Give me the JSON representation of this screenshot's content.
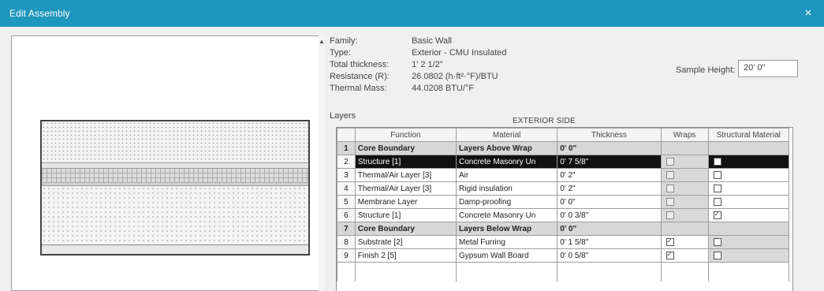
{
  "window": {
    "title": "Edit Assembly",
    "close_icon": "×"
  },
  "assembly": {
    "family_label": "Family:",
    "family_value": "Basic Wall",
    "type_label": "Type:",
    "type_value": "Exterior - CMU Insulated",
    "total_thickness_label": "Total thickness:",
    "total_thickness_value": "1' 2 1/2\"",
    "resistance_label": "Resistance (R):",
    "resistance_value": "26.0802 (h·ft²·°F)/BTU",
    "thermal_mass_label": "Thermal Mass:",
    "thermal_mass_value": "44.0208 BTU/°F",
    "sample_height_label": "Sample Height:",
    "sample_height_value": "20' 0\""
  },
  "layers": {
    "label": "Layers",
    "exterior_side": "EXTERIOR SIDE",
    "columns": [
      "",
      "Function",
      "Material",
      "Thickness",
      "Wraps",
      "Structural Material"
    ],
    "rows": [
      {
        "num": "1",
        "function": "Core Boundary",
        "material": "Layers Above Wrap",
        "thickness": "0' 0\"",
        "wraps": "",
        "wraps_checked": false,
        "structural": "",
        "struct_checked": false,
        "type": "boundary"
      },
      {
        "num": "2",
        "function": "Structure [1]",
        "material": "Concrete Masonry Un",
        "thickness": "0' 7 5/8\"",
        "wraps": "",
        "wraps_checked": false,
        "structural": "",
        "struct_checked": false,
        "type": "selected"
      },
      {
        "num": "3",
        "function": "Thermal/Air Layer [3]",
        "material": "Air",
        "thickness": "0' 2\"",
        "wraps": "",
        "wraps_checked": false,
        "structural": "",
        "struct_checked": false,
        "type": "normal"
      },
      {
        "num": "4",
        "function": "Thermal/Air Layer [3]",
        "material": "Rigid insulation",
        "thickness": "0' 2\"",
        "wraps": "",
        "wraps_checked": false,
        "structural": "",
        "struct_checked": false,
        "type": "normal"
      },
      {
        "num": "5",
        "function": "Membrane Layer",
        "material": "Damp-proofing",
        "thickness": "0' 0\"",
        "wraps": "",
        "wraps_checked": false,
        "structural": "",
        "struct_checked": false,
        "type": "normal"
      },
      {
        "num": "6",
        "function": "Structure [1]",
        "material": "Concrete Masonry Un",
        "thickness": "0' 0 3/8\"",
        "wraps": "",
        "wraps_checked": false,
        "structural": "",
        "struct_checked": true,
        "type": "normal"
      },
      {
        "num": "7",
        "function": "Core Boundary",
        "material": "Layers Below Wrap",
        "thickness": "0' 0\"",
        "wraps": "",
        "wraps_checked": false,
        "structural": "",
        "struct_checked": false,
        "type": "boundary"
      },
      {
        "num": "8",
        "function": "Substrate [2]",
        "material": "Metal Furring",
        "thickness": "0' 1 5/8\"",
        "wraps": "",
        "wraps_checked": true,
        "structural": "",
        "struct_checked": false,
        "type": "normal"
      },
      {
        "num": "9",
        "function": "Finish 2 [5]",
        "material": "Gypsum Wall Board",
        "thickness": "0' 0 5/8\"",
        "wraps": "",
        "wraps_checked": true,
        "structural": "",
        "struct_checked": false,
        "type": "normal"
      }
    ]
  }
}
